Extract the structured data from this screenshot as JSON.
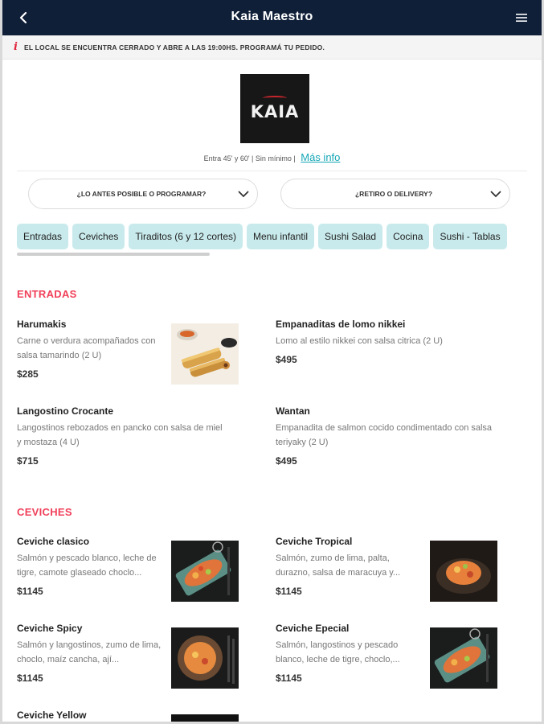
{
  "header": {
    "title": "Kaia Maestro",
    "back_icon": "chevron-left-icon",
    "menu_icon": "hamburger-icon"
  },
  "notice": {
    "icon": "i",
    "text": "EL LOCAL SE ENCUENTRA CERRADO Y ABRE A LAS 19:00HS. PROGRAMÁ TU PEDIDO."
  },
  "store": {
    "logo_text": "KAIA",
    "info_text": "Entra 45' y 60' | Sin mínimo |",
    "more_info": "Más info"
  },
  "selectors": {
    "schedule": "¿LO ANTES POSIBLE O PROGRAMAR?",
    "delivery": "¿RETIRO O DELIVERY?"
  },
  "categories": [
    "Entradas",
    "Ceviches",
    "Tiraditos (6 y 12 cortes)",
    "Menu infantil",
    "Sushi Salad",
    "Cocina",
    "Sushi - Tablas"
  ],
  "sections": {
    "entradas": {
      "title": "ENTRADAS",
      "items": [
        {
          "name": "Harumakis",
          "desc": "Carne o verdura acompañados con salsa tamarindo (2 U)",
          "price": "$285"
        },
        {
          "name": "Empanaditas de lomo nikkei",
          "desc": "Lomo al estilo nikkei con salsa citrica (2 U)",
          "price": "$495"
        },
        {
          "name": "Langostino Crocante",
          "desc": "Langostinos rebozados en pancko con salsa de miel y mostaza (4 U)",
          "price": "$715"
        },
        {
          "name": "Wantan",
          "desc": "Empanadita de salmon cocido condimentado con salsa teriyaky (2 U)",
          "price": "$495"
        }
      ]
    },
    "ceviches": {
      "title": "CEVICHES",
      "items": [
        {
          "name": "Ceviche clasico",
          "desc": "Salmón y pescado blanco, leche de tigre, camote glaseado choclo...",
          "price": "$1145"
        },
        {
          "name": "Ceviche Tropical",
          "desc": "Salmón, zumo de lima, palta, durazno, salsa de maracuya y...",
          "price": "$1145"
        },
        {
          "name": "Ceviche Spicy",
          "desc": "Salmón y langostinos, zumo de lima, choclo, maíz cancha, ají...",
          "price": "$1145"
        },
        {
          "name": "Ceviche Epecial",
          "desc": "Salmón, langostinos y pescado blanco, leche de tigre, choclo,...",
          "price": "$1145"
        },
        {
          "name": "Ceviche Yellow",
          "desc": "",
          "price": ""
        }
      ]
    }
  },
  "colors": {
    "header_bg": "#0f1f38",
    "accent_red": "#f0405a",
    "link_teal": "#16a7b7",
    "chip_bg": "#c9eaec"
  }
}
